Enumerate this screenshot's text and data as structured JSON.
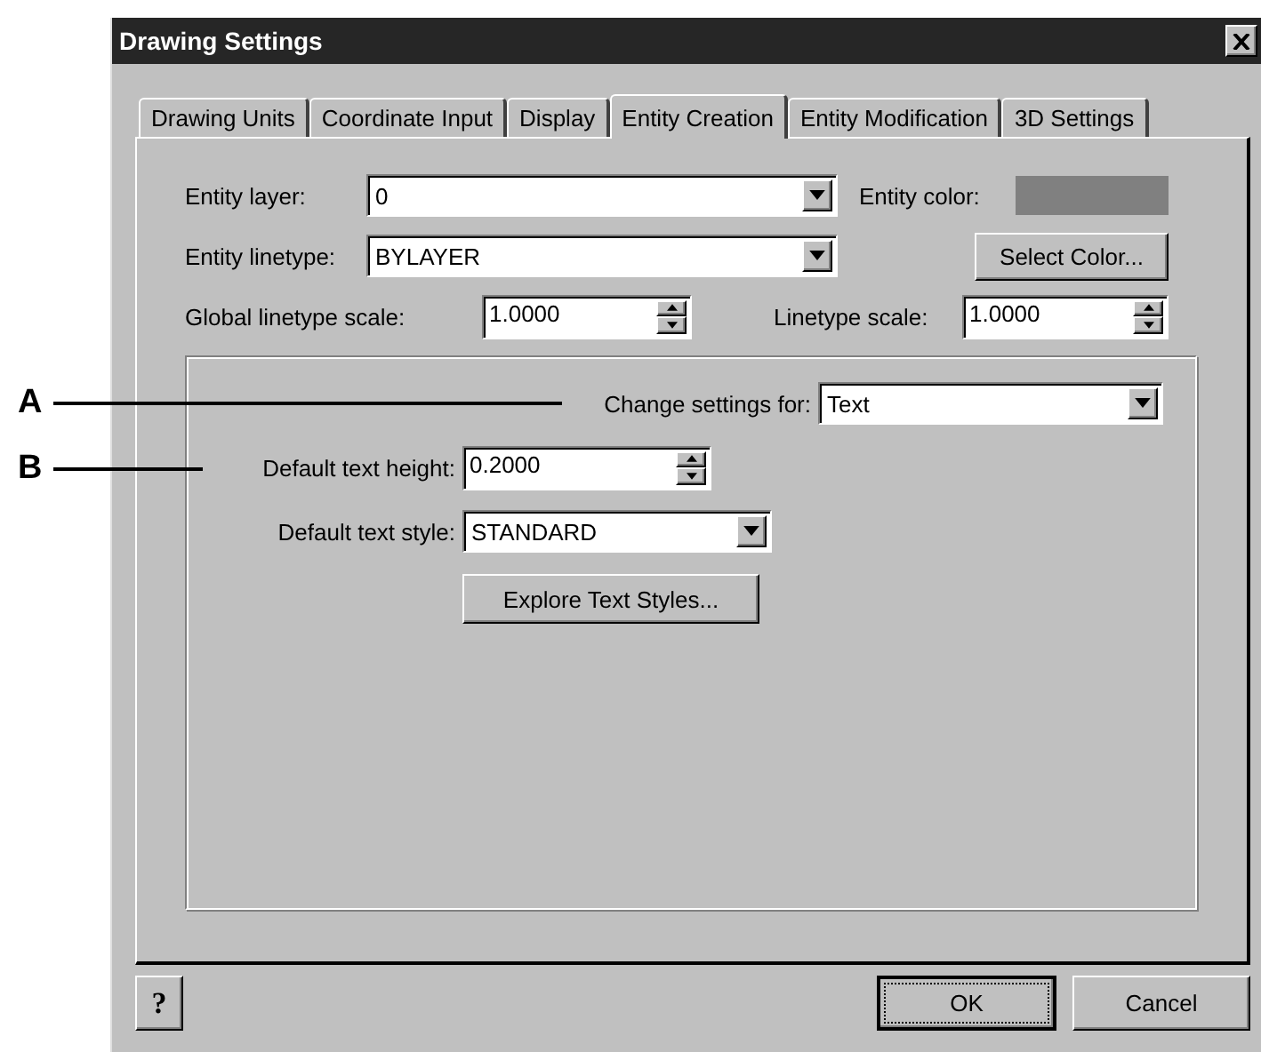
{
  "window": {
    "title": "Drawing Settings"
  },
  "tabs": [
    {
      "label": "Drawing Units",
      "selected": false
    },
    {
      "label": "Coordinate Input",
      "selected": false
    },
    {
      "label": "Display",
      "selected": false
    },
    {
      "label": "Entity Creation",
      "selected": true
    },
    {
      "label": "Entity Modification",
      "selected": false
    },
    {
      "label": "3D Settings",
      "selected": false
    }
  ],
  "entity_layer": {
    "label": "Entity layer:",
    "value": "0"
  },
  "entity_color": {
    "label": "Entity color:",
    "color": "#808080"
  },
  "entity_linetype": {
    "label": "Entity linetype:",
    "value": "BYLAYER"
  },
  "select_color_button": "Select Color...",
  "global_linetype_scale": {
    "label": "Global linetype scale:",
    "value": "1.0000"
  },
  "linetype_scale": {
    "label": "Linetype scale:",
    "value": "1.0000"
  },
  "settings_group": {
    "change_settings_for": {
      "label": "Change settings for:",
      "value": "Text"
    },
    "default_text_height": {
      "label": "Default text height:",
      "value": "0.2000"
    },
    "default_text_style": {
      "label": "Default text style:",
      "value": "STANDARD"
    },
    "explore_button": "Explore Text Styles..."
  },
  "callouts": [
    {
      "label": "A"
    },
    {
      "label": "B"
    }
  ],
  "help_button": "?",
  "buttons": [
    {
      "label": "OK",
      "focused": true
    },
    {
      "label": "Cancel",
      "focused": false
    }
  ]
}
